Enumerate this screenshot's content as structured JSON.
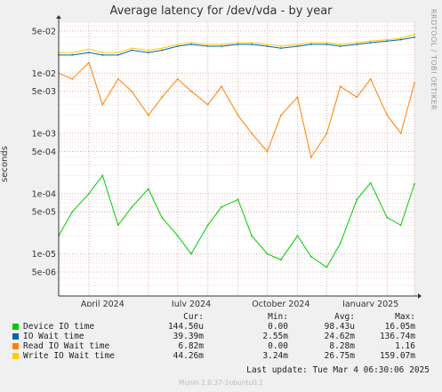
{
  "chart_data": {
    "type": "line",
    "title": "Average latency for /dev/vda - by year",
    "ylabel": "seconds",
    "yscale": "log",
    "ylim": [
      2e-06,
      0.07
    ],
    "grid": true,
    "x_ticks": [
      "April 2024",
      "July 2024",
      "October 2024",
      "January 2025"
    ],
    "y_ticks": [
      "5e-06",
      "1e-05",
      "5e-05",
      "1e-04",
      "5e-04",
      "1e-03",
      "5e-03",
      "1e-02",
      "5e-02"
    ],
    "x": [
      "2024-03-01",
      "2024-03-15",
      "2024-04-01",
      "2024-04-15",
      "2024-05-01",
      "2024-05-15",
      "2024-06-01",
      "2024-06-15",
      "2024-07-01",
      "2024-07-15",
      "2024-08-01",
      "2024-08-15",
      "2024-09-01",
      "2024-09-15",
      "2024-10-01",
      "2024-10-15",
      "2024-11-01",
      "2024-11-15",
      "2024-12-01",
      "2024-12-15",
      "2025-01-01",
      "2025-01-15",
      "2025-02-01",
      "2025-02-15",
      "2025-03-01"
    ],
    "series": [
      {
        "name": "Device IO time",
        "color": "#00cc00",
        "values": [
          2e-05,
          5e-05,
          0.0001,
          0.0002,
          3e-05,
          6e-05,
          0.00012,
          4e-05,
          2e-05,
          1e-05,
          3e-05,
          6e-05,
          8e-05,
          2e-05,
          1e-05,
          8e-06,
          2e-05,
          9e-06,
          6e-06,
          1.5e-05,
          8e-05,
          0.00015,
          4e-05,
          3e-05,
          0.0001445
        ]
      },
      {
        "name": "IO Wait time",
        "color": "#0066b3",
        "values": [
          0.02,
          0.02,
          0.022,
          0.02,
          0.02,
          0.024,
          0.022,
          0.024,
          0.028,
          0.03,
          0.028,
          0.028,
          0.03,
          0.03,
          0.028,
          0.026,
          0.028,
          0.03,
          0.03,
          0.028,
          0.03,
          0.032,
          0.034,
          0.036,
          0.03939
        ]
      },
      {
        "name": "Read IO Wait time",
        "color": "#ff8000",
        "values": [
          0.01,
          0.008,
          0.015,
          0.003,
          0.008,
          0.005,
          0.002,
          0.004,
          0.008,
          0.005,
          0.003,
          0.006,
          0.002,
          0.001,
          0.0005,
          0.002,
          0.004,
          0.0004,
          0.001,
          0.006,
          0.004,
          0.008,
          0.002,
          0.001,
          0.00682
        ]
      },
      {
        "name": "Write IO Wait time",
        "color": "#ffcc00",
        "values": [
          0.022,
          0.022,
          0.025,
          0.022,
          0.022,
          0.026,
          0.024,
          0.026,
          0.03,
          0.032,
          0.03,
          0.03,
          0.032,
          0.032,
          0.03,
          0.028,
          0.03,
          0.032,
          0.032,
          0.03,
          0.032,
          0.034,
          0.036,
          0.038,
          0.04426
        ]
      }
    ]
  },
  "side_label": "RRDTOOL / TOBI OETIKER",
  "legend": {
    "headers": {
      "cur": "Cur:",
      "min": "Min:",
      "avg": "Avg:",
      "max": "Max:"
    },
    "rows": [
      {
        "label": "Device IO time",
        "color": "#00cc00",
        "cur": "144.50u",
        "min": "0.00",
        "avg": "98.43u",
        "max": "16.05m"
      },
      {
        "label": "IO Wait time",
        "color": "#0066b3",
        "cur": "39.39m",
        "min": "2.55m",
        "avg": "24.62m",
        "max": "136.74m"
      },
      {
        "label": "Read IO Wait time",
        "color": "#ff8000",
        "cur": "6.82m",
        "min": "0.00",
        "avg": "8.28m",
        "max": "1.16"
      },
      {
        "label": "Write IO Wait time",
        "color": "#ffcc00",
        "cur": "44.26m",
        "min": "3.24m",
        "avg": "26.75m",
        "max": "159.07m"
      }
    ]
  },
  "last_update": "Last update: Tue Mar  4 06:30:06 2025",
  "footer": "Munin 2.0.37-1ubuntu0.1"
}
